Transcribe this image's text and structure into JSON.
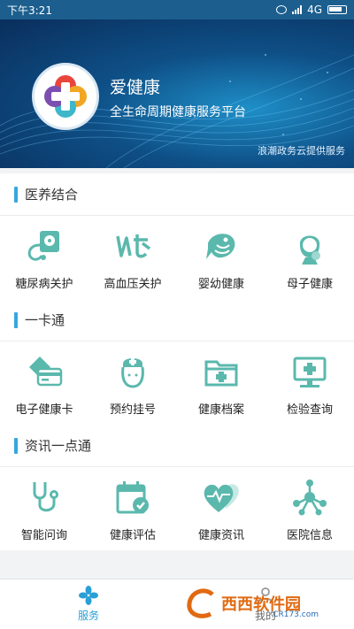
{
  "status_bar": {
    "time": "下午3:21",
    "network": "4G"
  },
  "banner": {
    "title": "爱健康",
    "subtitle": "全生命周期健康服务平台",
    "provider": "浪潮政务云提供服务"
  },
  "sections": [
    {
      "title": "医养结合",
      "items": [
        {
          "label": "糖尿病关护",
          "icon": "blood-pressure-meter-icon"
        },
        {
          "label": "高血压关护",
          "icon": "hypertension-icon"
        },
        {
          "label": "婴幼健康",
          "icon": "baby-fish-icon"
        },
        {
          "label": "母子健康",
          "icon": "mother-child-icon"
        }
      ]
    },
    {
      "title": "一卡通",
      "items": [
        {
          "label": "电子健康卡",
          "icon": "health-card-icon"
        },
        {
          "label": "预约挂号",
          "icon": "nurse-icon"
        },
        {
          "label": "健康档案",
          "icon": "medical-folder-icon"
        },
        {
          "label": "检验查询",
          "icon": "monitor-cross-icon"
        }
      ]
    },
    {
      "title": "资讯一点通",
      "items": [
        {
          "label": "智能问询",
          "icon": "stethoscope-icon"
        },
        {
          "label": "健康评估",
          "icon": "calendar-check-icon"
        },
        {
          "label": "健康资讯",
          "icon": "heart-pulse-icon"
        },
        {
          "label": "医院信息",
          "icon": "network-nodes-icon"
        }
      ]
    }
  ],
  "tabbar": [
    {
      "label": "服务",
      "active": true
    },
    {
      "label": "我的",
      "active": false
    }
  ],
  "watermark": {
    "text": "西西软件园",
    "url": "CR173.com"
  },
  "colors": {
    "accent": "#35a7e0",
    "icon_teal": "#5bb8ad",
    "tab_active": "#2a9fd6"
  }
}
